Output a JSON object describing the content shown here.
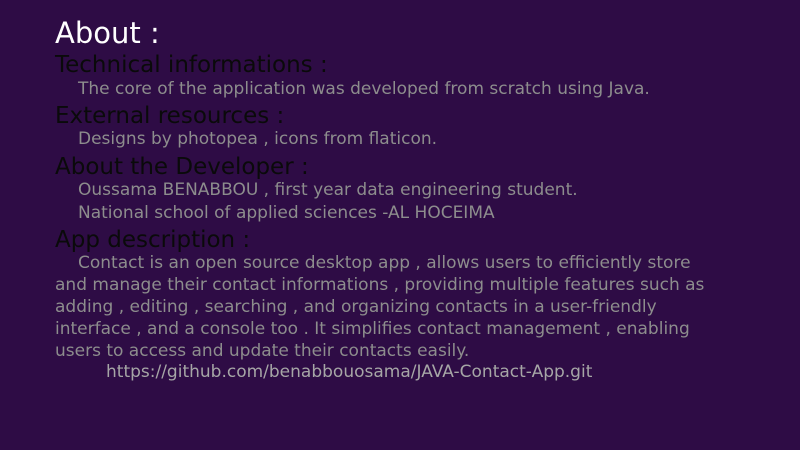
{
  "about": {
    "title": "About :",
    "technical": {
      "heading": "Technical informations :",
      "text": "The core of the application was developed from scratch using Java."
    },
    "external": {
      "heading": "External resources :",
      "text": "Designs by photopea , icons from flaticon."
    },
    "developer": {
      "heading": "About the Developer :",
      "line1": "Oussama BENABBOU , first year data engineering student.",
      "line2": "National school of applied sciences -AL HOCEIMA"
    },
    "description": {
      "heading": "App description :",
      "lines": [
        "Contact is an open source desktop app , allows users to efficiently store",
        "and manage their contact informations , providing multiple features such as",
        "adding , editing , searching , and organizing contacts in a user-friendly",
        "interface , and a console too . It simplifies contact management , enabling",
        "users to access and update their contacts easily."
      ],
      "link": "https://github.com/benabbouosama/JAVA-Contact-App.git"
    }
  }
}
